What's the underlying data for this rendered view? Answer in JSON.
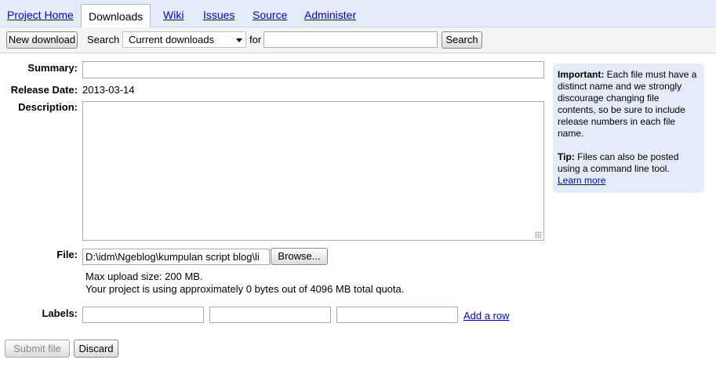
{
  "tabs": [
    {
      "label": "Project Home",
      "active": false
    },
    {
      "label": "Downloads",
      "active": true
    },
    {
      "label": "Wiki",
      "active": false
    },
    {
      "label": "Issues",
      "active": false
    },
    {
      "label": "Source",
      "active": false
    },
    {
      "label": "Administer",
      "active": false
    }
  ],
  "toolbar": {
    "new_download_label": "New download",
    "search_label": "Search",
    "scope_selected": "Current downloads",
    "for_label": "for",
    "query_value": "",
    "search_button_label": "Search"
  },
  "form": {
    "summary_label": "Summary:",
    "summary_value": "",
    "release_date_label": "Release Date:",
    "release_date_value": "2013-03-14",
    "description_label": "Description:",
    "description_value": "",
    "file_label": "File:",
    "file_value": "D:\\idm\\Ngeblog\\kumpulan script blog\\li",
    "browse_label": "Browse...",
    "max_upload": "Max upload size: 200 MB.",
    "quota": "Your project is using approximately 0 bytes out of 4096 MB total quota.",
    "labels_label": "Labels:",
    "label_values": [
      "",
      "",
      ""
    ],
    "add_row_label": "Add a row",
    "submit_label": "Submit file",
    "discard_label": "Discard"
  },
  "info": {
    "important_heading": "Important:",
    "important_text": " Each file must have a distinct name and we strongly discourage changing file contents, so be sure to include release numbers in each file name.",
    "tip_heading": "Tip:",
    "tip_text": " Files can also be posted using a command line tool.",
    "learn_more_label": "Learn more"
  },
  "colors": {
    "tab_bar_bg": "#e5ecf9",
    "info_box_bg": "#e5ecf9",
    "link": "#0000cc"
  }
}
